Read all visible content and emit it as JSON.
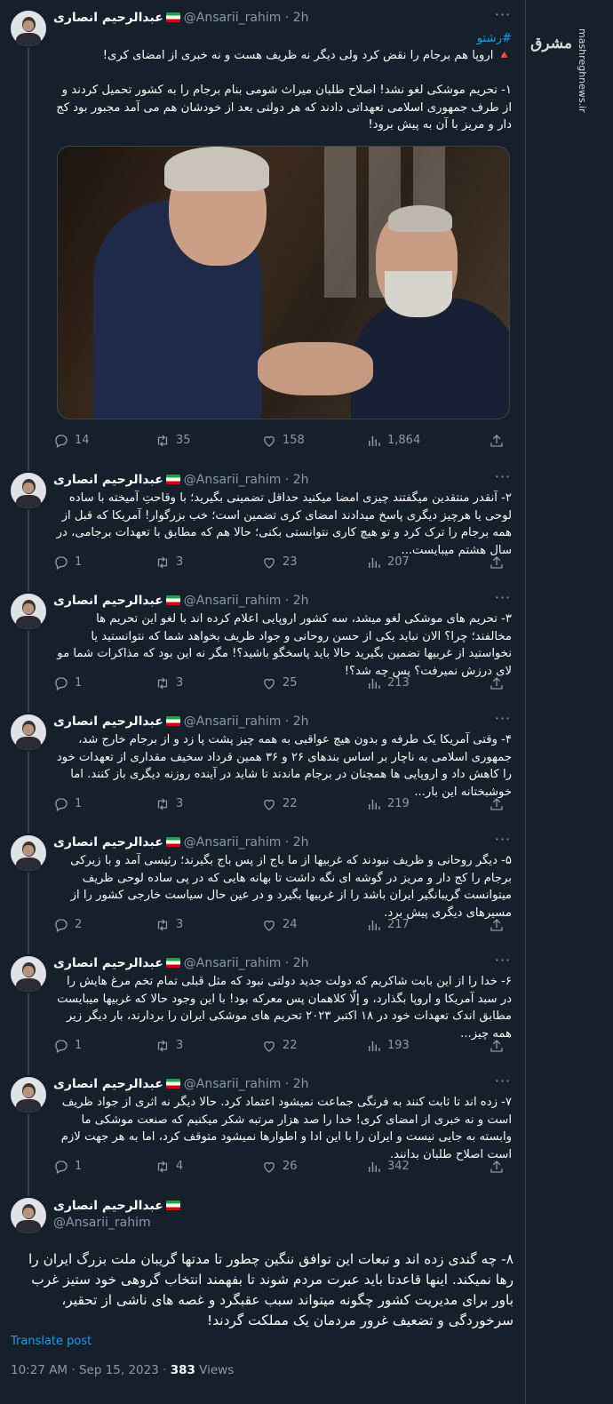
{
  "watermark": {
    "logo": "مشرق",
    "url": "mashreghnews.ir"
  },
  "author": {
    "name": "عبدالرحیم انصاری",
    "handle": "@Ansarii_rahim",
    "dot": "·",
    "time": "2h"
  },
  "tweets": [
    {
      "hashtag": "#رشتو",
      "text": "🔺 اروپا هم برجام را نقض کرد ولی دیگر نه ظریف هست و نه خبری از امضای کری!\n\n۱- تحریم موشکی لغو نشد! اصلاح طلبان میراث شومی بنام برجام را به کشور تحمیل کردند و از طرف جمهوری اسلامی تعهداتی دادند که هر دولتی بعد از خودشان هم می آمد مجبور بود کج دار و مریز با آن به پیش برود!",
      "replies": "14",
      "retweets": "35",
      "likes": "158",
      "views": "1,864"
    },
    {
      "text": "۲- آنقدر منتقدین میگفتند چیزی امضا میکنید حداقل تضمینی بگیرید؛ با وقاحتِ آمیخته با ساده لوحی یا هرچیز دیگری پاسخ میدادند امضای کری تضمین است؛ خب بزرگوار! آمریکا که قبل از همه برجام را ترک کرد و تو هیچ کاری نتوانستی بکنی؛ حالا هم که مطابق با تعهدات برجامی، در سال هشتم میبایست...",
      "replies": "1",
      "retweets": "3",
      "likes": "23",
      "views": "207"
    },
    {
      "text": "۳- تحریم های موشکی لغو میشد، سه کشور اروپایی اعلام کرده اند با لغو این تحریم ها مخالفند؛ چرا؟ الان نباید یکی از حسن روحانی و جواد ظریف بخواهد شما که نتوانستید یا نخواستید از غربیها تضمین بگیرید حالا باید پاسخگو باشید؟! مگر نه این بود که مذاکرات شما مو لای درزش نمیرفت؟ پس چه شد؟!",
      "replies": "1",
      "retweets": "3",
      "likes": "25",
      "views": "213"
    },
    {
      "text": "۴- وقتی آمریکا یک طرفه و بدون هیچ عواقبی به همه چیز پشت پا زد و از برجام خارج شد، جمهوری اسلامی به ناچار بر اساس بندهای ۲۶ و ۳۶ همین قرداد سخیف مقداری از تعهدات خود را کاهش داد و اروپایی ها همچنان در برجام ماندند تا شاید در آینده روزنه دیگری باز کنند. اما خوشبختانه این بار...",
      "replies": "1",
      "retweets": "3",
      "likes": "22",
      "views": "219"
    },
    {
      "text": "۵- دیگر روحانی و ظریف نبودند که غربیها از ما باج از پس باج بگیرند؛ رئیسی آمد و با زیرکی برجام را کج دار و مریز در گوشه ای نگه داشت تا بهانه هایی که در پی ساده لوحی ظریف میتوانست گریبانگیر ایران باشد را از غربیها بگیرد و در عین حال سیاست خارجی کشور را از مسیرهای دیگری پیش برد.",
      "replies": "2",
      "retweets": "3",
      "likes": "24",
      "views": "217"
    },
    {
      "text": "۶- خدا را از این بابت شاکریم که دولت جدید دولتی نبود که مثل قبلی تمام تخم مرغ هایش را در سبد آمریکا و اروپا بگذارد، و إلّا کلاهمان پس معرکه بود! با این وجود حالا که غربیها میبایست مطابق اندک تعهدات خود در ۱۸ اکتبر ۲۰۲۳ تحریم های موشکی ایران را بردارند، بار دیگر زیر همه چیز...",
      "replies": "1",
      "retweets": "3",
      "likes": "22",
      "views": "193"
    },
    {
      "text": "۷- زده اند تا ثابت کنند به فرنگی جماعت نمیشود اعتماد کرد. حالا دیگر نه اثری از جواد ظریف است و نه خبری از امضای کری! خدا را صد هزار مرتبه شکر میکنیم که صنعت موشکی ما وابسته به جایی نیست و ایران را با این ادا و اطوارها نمیشود متوقف کرد، اما به هر جهت لازم است اصلاح طلبان بدانند.",
      "replies": "1",
      "retweets": "4",
      "likes": "26",
      "views": "342"
    }
  ],
  "main_tweet": {
    "text": "۸- چه گندی زده اند و تبعات این توافق ننگین چطور تا مدتها گریبان ملت بزرگ ایران را رها نمیکند. اینها قاعدتا باید عبرت مردم شوند تا بفهمند انتخاب گروهی خود ستیز غرب باور برای مدیریت کشور چگونه میتواند سبب عقبگرد و غصه های ناشی از تحقیر، سرخوردگی و تضعیف غرور مردمان یک مملکت گردند!",
    "translate_label": "Translate post",
    "timestamp": "10:27 AM · Sep 15, 2023 · ",
    "views_count": "383",
    "views_label": " Views"
  },
  "colors": {
    "background": "#15202b",
    "accent": "#1d9bf0",
    "muted": "#8b98a5",
    "border": "#38444d"
  },
  "icons": [
    "more-icon",
    "reply-icon",
    "retweet-icon",
    "like-icon",
    "views-icon",
    "share-icon",
    "iran-flag-icon"
  ]
}
